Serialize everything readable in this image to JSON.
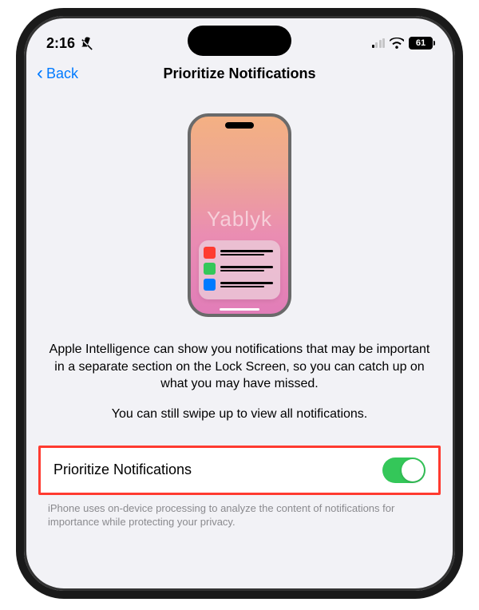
{
  "statusBar": {
    "time": "2:16",
    "battery": "61"
  },
  "nav": {
    "backLabel": "Back",
    "title": "Prioritize Notifications"
  },
  "description1": "Apple Intelligence can show you notifications that may be important in a separate section on the Lock Screen, so you can catch up on what you may have missed.",
  "description2": "You can still swipe up to view all notifications.",
  "toggle": {
    "label": "Prioritize Notifications",
    "enabled": true
  },
  "footer": "iPhone uses on-device processing to analyze the content of notifications for importance while protecting your privacy.",
  "watermark": "Yablyk"
}
